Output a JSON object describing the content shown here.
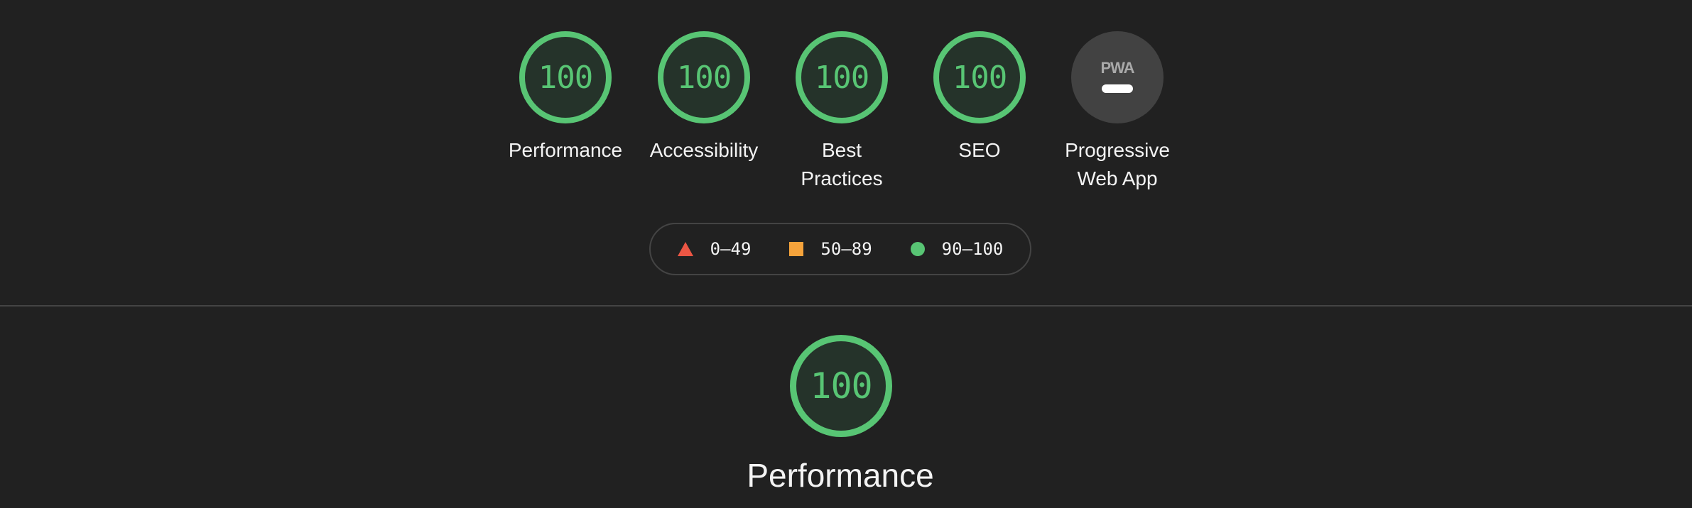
{
  "gauges": [
    {
      "score": "100",
      "label": "Performance"
    },
    {
      "score": "100",
      "label": "Accessibility"
    },
    {
      "score": "100",
      "label": "Best Practices"
    },
    {
      "score": "100",
      "label": "SEO"
    }
  ],
  "pwa": {
    "logo": "PWA",
    "label": "Progressive Web App"
  },
  "legend": {
    "fail": "0–49",
    "average": "50–89",
    "pass": "90–100"
  },
  "category": {
    "score": "100",
    "title": "Performance"
  },
  "colors": {
    "background": "#212121",
    "pass": "#58c574",
    "average": "#f5a33b",
    "fail": "#ec5644",
    "pwa_bg": "#424242"
  },
  "icons": {
    "fail": "red-triangle-icon",
    "average": "orange-square-icon",
    "pass": "green-circle-icon",
    "pwa": "pwa-badge-icon"
  }
}
